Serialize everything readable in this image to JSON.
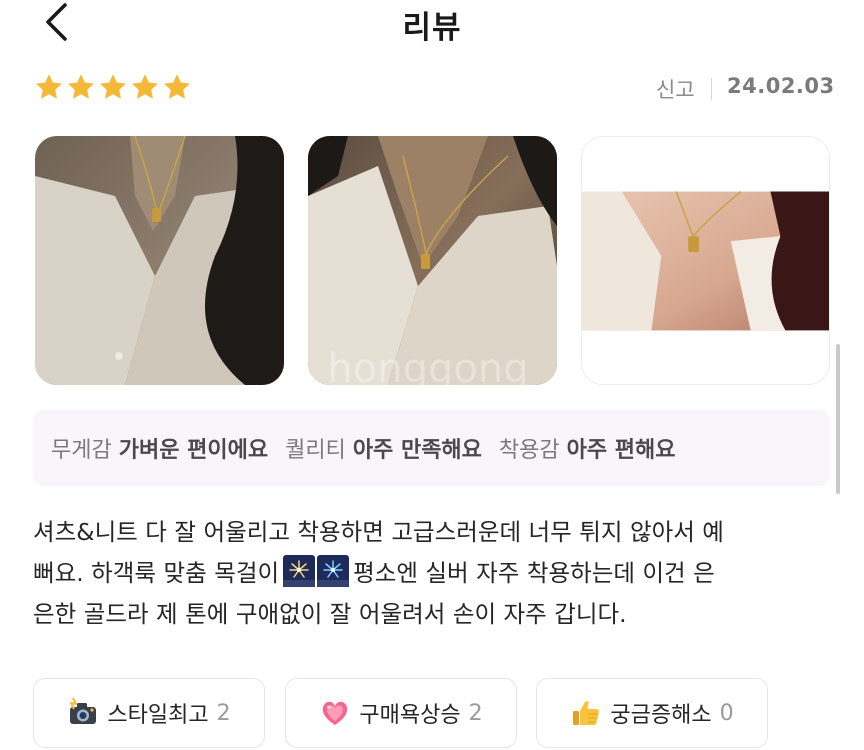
{
  "header": {
    "title": "리뷰",
    "back_icon": "chevron-left-icon"
  },
  "review": {
    "rating": 5,
    "rating_max": 5,
    "star_color": "#F5B93A",
    "report_label": "신고",
    "date": "24.02.03",
    "photos": [
      {
        "icon": "review-photo"
      },
      {
        "icon": "review-photo"
      },
      {
        "icon": "review-photo"
      }
    ],
    "tags": [
      {
        "question": "무게감",
        "answer": "가벼운 편이에요"
      },
      {
        "question": "퀄리티",
        "answer": "아주 만족해요"
      },
      {
        "question": "착용감",
        "answer": "아주 편해요"
      }
    ],
    "text_lines": [
      "셔츠&니트 다 잘 어울리고 착용하면 고급스러운데 너무 튀지 않아서 예",
      "뻐요. 하객룩 맞춤 목걸이",
      "평소엔 실버 자주 착용하는데 이건 은",
      "은한 골드라 제 톤에 구애없이 잘 어울려서 손이 자주 갑니다."
    ],
    "inline_emoji": [
      "fireworks-icon",
      "fireworks-icon"
    ]
  },
  "reactions": [
    {
      "icon": "camera-flash-icon",
      "label": "스타일최고",
      "count": "2"
    },
    {
      "icon": "heart-icon",
      "label": "구매욕상승",
      "count": "2"
    },
    {
      "icon": "thumbs-up-icon",
      "label": "궁금증해소",
      "count": "0"
    }
  ]
}
